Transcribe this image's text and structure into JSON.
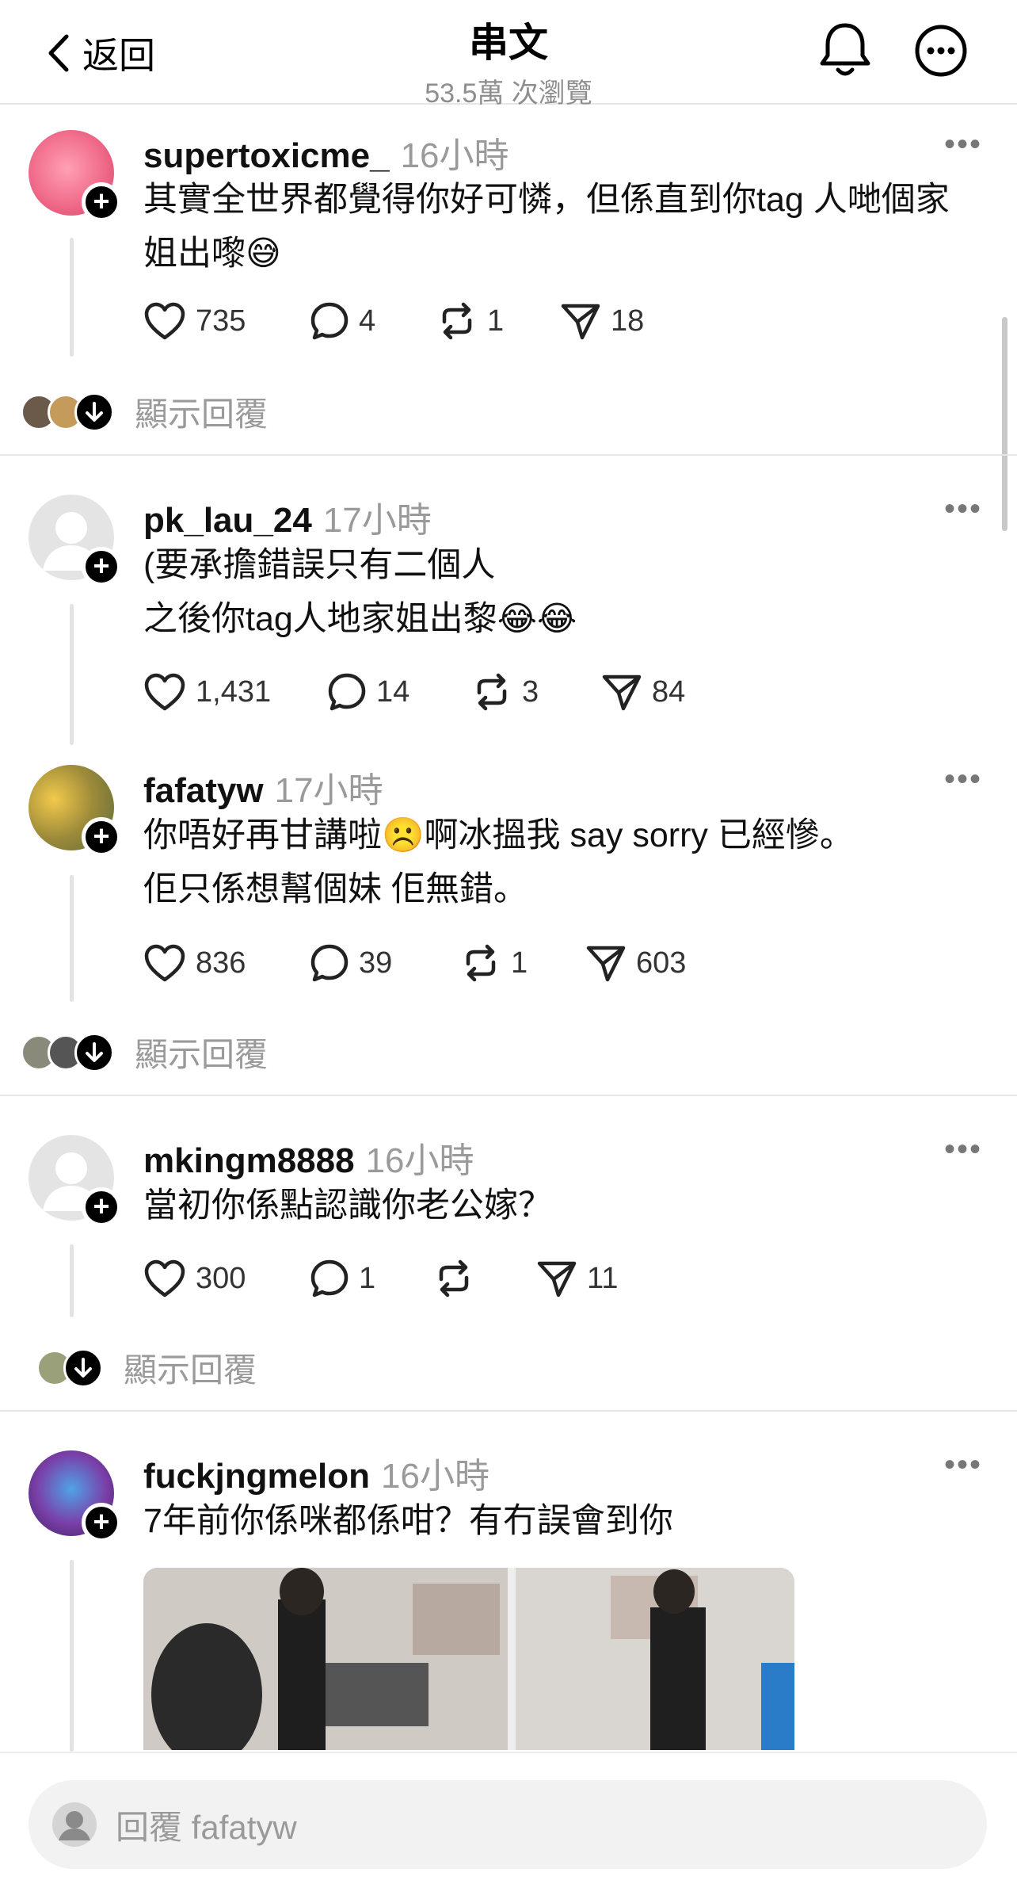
{
  "header": {
    "back_label": "返回",
    "title": "串文",
    "views": "53.5萬 次瀏覽"
  },
  "posts": [
    {
      "username": "supertoxicme_",
      "time": "16小時",
      "text": "其實全世界都覺得你好可憐，但係直到你tag 人哋個家姐出嚟😅",
      "likes": "735",
      "comments": "4",
      "reposts": "1",
      "shares": "18",
      "show_replies": "顯示回覆",
      "avatar_color": "#f06b8a"
    },
    {
      "username": "pk_lau_24",
      "time": "17小時",
      "text": "(要承擔錯誤只有二個人\n之後你tag人地家姐出黎😂😂",
      "likes": "1,431",
      "comments": "14",
      "reposts": "3",
      "shares": "84",
      "avatar_color": "#dcdcdc"
    },
    {
      "username": "fafatyw",
      "time": "17小時",
      "text": "你唔好再甘講啦☹️啊冰搵我 say sorry 已經慘。\n佢只係想幫個妹 佢無錯。",
      "likes": "836",
      "comments": "39",
      "reposts": "1",
      "shares": "603",
      "show_replies": "顯示回覆",
      "avatar_color": "#c9a24a"
    },
    {
      "username": "mkingm8888",
      "time": "16小時",
      "text": "當初你係點認識你老公嫁？",
      "likes": "300",
      "comments": "1",
      "reposts": "",
      "shares": "11",
      "show_replies": "顯示回覆",
      "avatar_color": "#dcdcdc"
    },
    {
      "username": "fuckjngmelon",
      "time": "16小時",
      "text": "7年前你係咪都係咁？有冇誤會到你",
      "avatar_color": "#7a3fa8"
    }
  ],
  "reply_bar": {
    "placeholder": "回覆 fafatyw"
  },
  "colors": {
    "muted": "#9a9a9a",
    "divider": "#e6e6e6",
    "accent": "#000000"
  }
}
